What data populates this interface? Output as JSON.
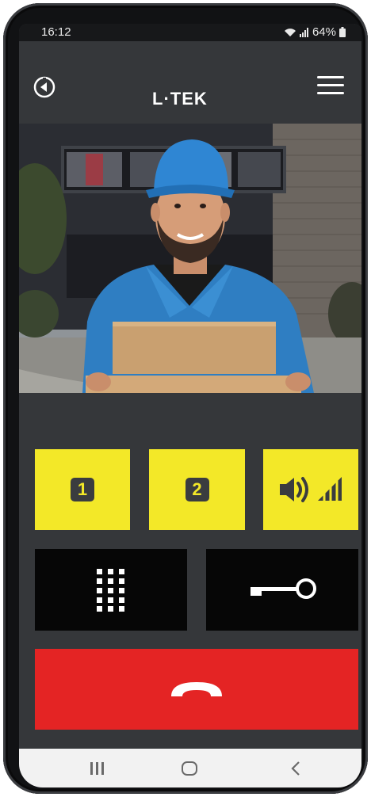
{
  "status_bar": {
    "time": "16:12",
    "battery": "64%"
  },
  "header": {
    "brand": "L·TEK",
    "back_icon": "back-circle-icon",
    "menu_icon": "hamburger-menu-icon"
  },
  "camera": {
    "description_icon": "door-camera-feed"
  },
  "controls": {
    "relay1_label": "1",
    "relay2_label": "2",
    "volume_icon": "speaker-volume-icon",
    "keypad_icon": "keypad-icon",
    "key_icon": "key-icon",
    "hangup_icon": "hang-up-icon"
  },
  "nav": {
    "recents_icon": "recents-icon",
    "home_icon": "home-icon",
    "back_icon": "nav-back-icon"
  },
  "colors": {
    "accent_yellow": "#f3e828",
    "hangup_red": "#e42424",
    "background": "#35373a",
    "button_black": "#060606"
  }
}
